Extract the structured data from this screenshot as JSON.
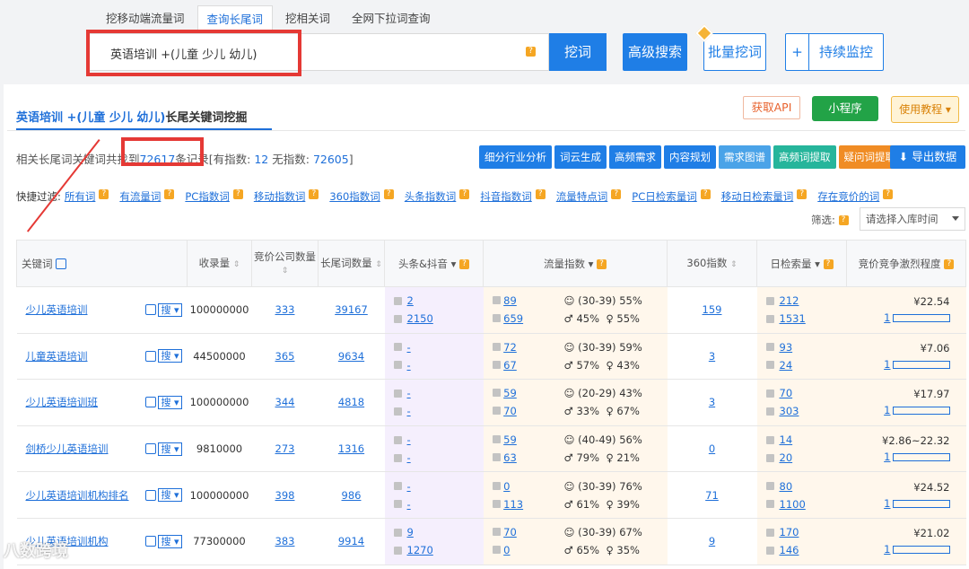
{
  "tabs": [
    "挖移动端流量词",
    "查询长尾词",
    "挖相关词",
    "全网下拉词查询"
  ],
  "search_value": "英语培训 +(儿童 少儿 幼儿)",
  "buttons": {
    "dig": "挖词",
    "adv": "高级搜索",
    "batch": "批量挖词",
    "plus": "+",
    "monitor": "持续监控",
    "api": "获取API",
    "mini": "小程序",
    "tutorial": "使用教程",
    "export": "导出数据"
  },
  "panel_title_kw": "英语培训 +(儿童 少儿 幼儿)",
  "panel_title_suffix": "长尾关键词挖掘",
  "count_text": {
    "a": "相关长尾词关键词共找到",
    "total": "72617",
    "b": "条记录[有指数:",
    "with_idx": "12",
    "c": "无指数:",
    "no_idx": "72605",
    "d": "]"
  },
  "filter_buttons": [
    "细分行业分析",
    "词云生成",
    "高频需求",
    "内容规划",
    "需求图谱",
    "高频词提取",
    "疑问词提取"
  ],
  "quick_filter_label": "快捷过滤:",
  "quick_filters": [
    "所有词",
    "有流量词",
    "PC指数词",
    "移动指数词",
    "360指数词",
    "头条指数词",
    "抖音指数词",
    "流量特点词",
    "PC日检索量词",
    "移动日检索量词",
    "存在竞价的词"
  ],
  "select_label": "筛选:",
  "select_placeholder": "请选择入库时间",
  "headers": [
    "关键词",
    "收录量",
    "竞价公司数量",
    "长尾词数量",
    "头条&抖音",
    "流量指数",
    "360指数",
    "日检索量",
    "竞价竞争激烈程度"
  ],
  "rows": [
    {
      "kw": "少儿英语培训",
      "inc": "100000000",
      "bid": "333",
      "lt": "39167",
      "tt": "2",
      "dy": "2150",
      "f1": "89",
      "f2": "659",
      "age": "(30-39) 55%",
      "male": "45%",
      "female": "55%",
      "s360": "159",
      "d1": "212",
      "d2": "1531",
      "price": "¥22.54",
      "lvl": "1"
    },
    {
      "kw": "儿童英语培训",
      "inc": "44500000",
      "bid": "365",
      "lt": "9634",
      "tt": "-",
      "dy": "-",
      "f1": "72",
      "f2": "67",
      "age": "(30-39) 59%",
      "male": "57%",
      "female": "43%",
      "s360": "3",
      "d1": "93",
      "d2": "24",
      "price": "¥7.06",
      "lvl": "1"
    },
    {
      "kw": "少儿英语培训班",
      "inc": "100000000",
      "bid": "344",
      "lt": "4818",
      "tt": "-",
      "dy": "-",
      "f1": "59",
      "f2": "70",
      "age": "(20-29) 43%",
      "male": "33%",
      "female": "67%",
      "s360": "3",
      "d1": "70",
      "d2": "303",
      "price": "¥17.97",
      "lvl": "1"
    },
    {
      "kw": "剑桥少儿英语培训",
      "inc": "9810000",
      "bid": "273",
      "lt": "1316",
      "tt": "-",
      "dy": "-",
      "f1": "59",
      "f2": "63",
      "age": "(40-49) 56%",
      "male": "79%",
      "female": "21%",
      "s360": "0",
      "d1": "14",
      "d2": "20",
      "price": "¥2.86~22.32",
      "lvl": "1"
    },
    {
      "kw": "少儿英语培训机构排名",
      "inc": "100000000",
      "bid": "398",
      "lt": "986",
      "tt": "-",
      "dy": "-",
      "f1": "0",
      "f2": "113",
      "age": "(30-39) 76%",
      "male": "61%",
      "female": "39%",
      "s360": "71",
      "d1": "80",
      "d2": "1100",
      "price": "¥24.52",
      "lvl": "1"
    },
    {
      "kw": "少儿英语培训机构",
      "inc": "77300000",
      "bid": "383",
      "lt": "9914",
      "tt": "9",
      "dy": "1270",
      "f1": "70",
      "f2": "0",
      "age": "(30-39) 67%",
      "male": "65%",
      "female": "35%",
      "s360": "9",
      "d1": "170",
      "d2": "146",
      "price": "¥21.02",
      "lvl": "1"
    }
  ],
  "search_btn": "搜",
  "watermark": "八数跨境"
}
